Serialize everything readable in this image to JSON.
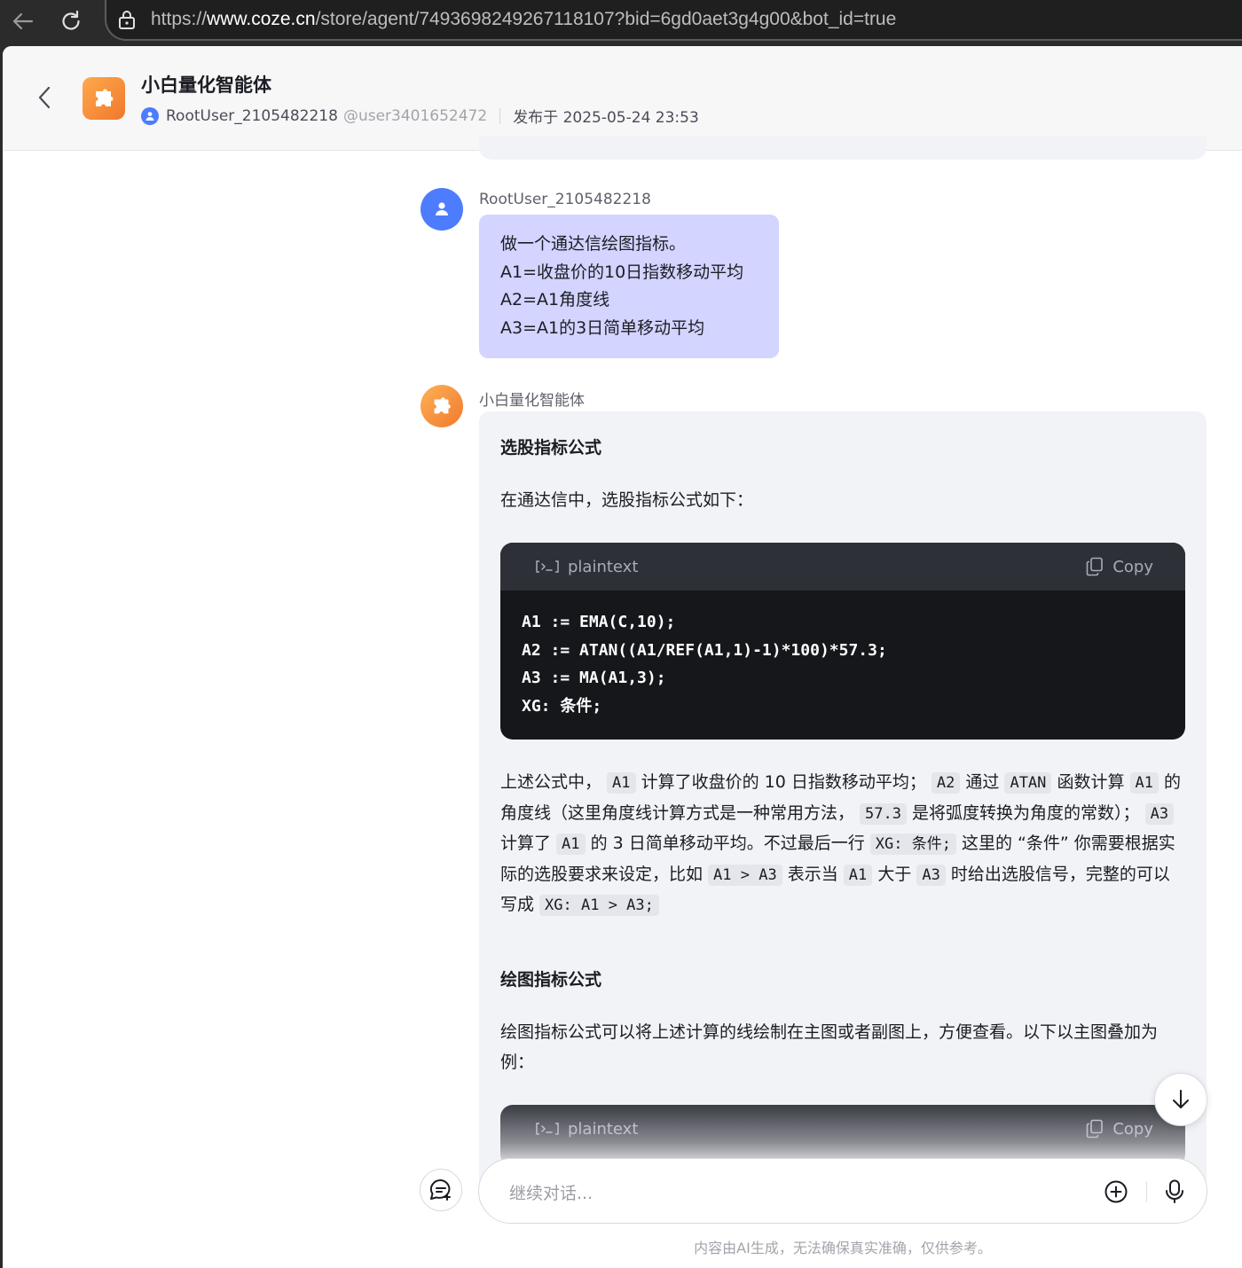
{
  "browser": {
    "url_prefix": "https://",
    "url_host": "www.coze.cn",
    "url_path": "/store/agent/7493698249267118107?bid=6gd0aet3g4g00&bot_id=true"
  },
  "header": {
    "title": "小白量化智能体",
    "author": "RootUser_2105482218",
    "handle": "@user3401652472",
    "published": "发布于 2025-05-24 23:53"
  },
  "messages": {
    "user": {
      "name": "RootUser_2105482218",
      "lines": [
        "做一个通达信绘图指标。",
        "A1=收盘价的10日指数移动平均",
        "A2=A1角度线",
        "A3=A1的3日简单移动平均"
      ]
    },
    "bot": {
      "name": "小白量化智能体",
      "section1_title": "选股指标公式",
      "section1_intro": "在通达信中，选股指标公式如下：",
      "code1": {
        "lang": "plaintext",
        "copy_label": "Copy",
        "lines": [
          "A1 := EMA(C,10);",
          "A2 := ATAN((A1/REF(A1,1)-1)*100)*57.3;",
          "A3 := MA(A1,3);",
          "XG: 条件;"
        ]
      },
      "explain": {
        "t1": "上述公式中， ",
        "c1": "A1",
        "t2": " 计算了收盘价的 10 日指数移动平均； ",
        "c2": "A2",
        "t3": " 通过 ",
        "c3": "ATAN",
        "t4": " 函数计算 ",
        "c4": "A1",
        "t5": " 的角度线（这里角度线计算方式是一种常用方法， ",
        "c5": "57.3",
        "t6": " 是将弧度转换为角度的常数）； ",
        "c6": "A3",
        "t7": " 计算了 ",
        "c7": "A1",
        "t8": " 的 3 日简单移动平均。不过最后一行 ",
        "c8": "XG: 条件;",
        "t9": " 这里的 “条件” 你需要根据实际的选股要求来设定，比如 ",
        "c9": "A1 > A3",
        "t10": " 表示当 ",
        "c10": "A1",
        "t11": " 大于 ",
        "c11": "A3",
        "t12": " 时给出选股信号，完整的可以写成 ",
        "c12": "XG: A1 > A3;"
      },
      "section2_title": "绘图指标公式",
      "section2_intro": "绘图指标公式可以将上述计算的线绘制在主图或者副图上，方便查看。以下以主图叠加为例：",
      "code2": {
        "lang": "plaintext",
        "copy_label": "Copy"
      }
    }
  },
  "input": {
    "placeholder": "继续对话..."
  },
  "disclaimer": "内容由AI生成，无法确保真实准确，仅供参考。",
  "colors": {
    "user_bubble": "#d3d4ff",
    "bot_bubble": "#f2f3f7",
    "accent_blue": "#4d7cfe",
    "bot_orange": "#f07a2c"
  },
  "icons": [
    "back-arrow-icon",
    "reload-icon",
    "lock-icon",
    "chevron-left-icon",
    "puzzle-icon",
    "user-icon",
    "terminal-icon",
    "copy-icon",
    "arrow-down-icon",
    "new-chat-icon",
    "plus-circle-icon",
    "microphone-icon"
  ]
}
